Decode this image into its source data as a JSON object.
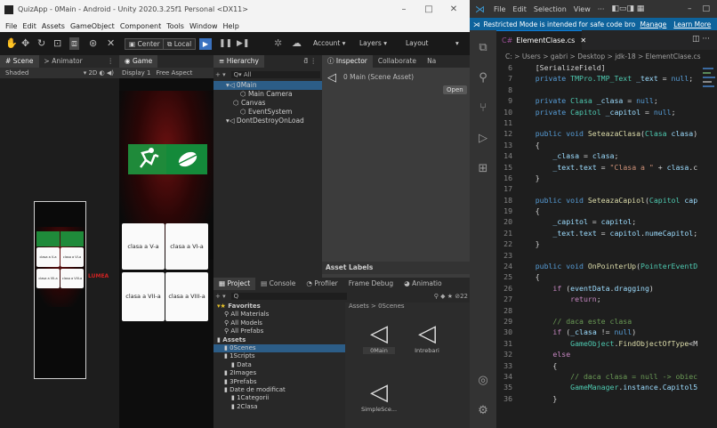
{
  "unity": {
    "title": "QuizApp - 0Main - Android - Unity 2020.3.25f1 Personal <DX11>",
    "window_controls": [
      "–",
      "□",
      "✕"
    ],
    "menu": [
      "File",
      "Edit",
      "Assets",
      "GameObject",
      "Component",
      "Tools",
      "Window",
      "Help"
    ],
    "toolbar": {
      "pivot": "Center",
      "space": "Local",
      "account": "Account ▾",
      "layers": "Layers ▾",
      "layout": "Layout"
    },
    "scene_tabs": [
      "# Scene",
      "≻ Animator"
    ],
    "scene_shading": "Shaded",
    "game_tab": "Game",
    "game_display": "Display 1",
    "game_aspect": "Free Aspect",
    "cards": [
      "clasa a V-a",
      "clasa a VI-a",
      "clasa a VII-a",
      "clasa a VIII-a"
    ],
    "scene_cards": [
      "clasa a V-a",
      "clasa a VI-a",
      "clasa a VII-a",
      "clasa a VIII-a"
    ],
    "scene_caption": "LUMEA",
    "hierarchy": {
      "tab": "Hierarchy",
      "search": "All",
      "items": [
        {
          "label": "0Main",
          "indent": 0
        },
        {
          "label": "Main Camera",
          "indent": 2
        },
        {
          "label": "Canvas",
          "indent": 1
        },
        {
          "label": "EventSystem",
          "indent": 2
        },
        {
          "label": "DontDestroyOnLoad",
          "indent": 0
        }
      ]
    },
    "inspector": {
      "tabs": [
        "Inspector",
        "Collaborate",
        "Na"
      ],
      "asset_name": "0 Main (Scene Asset)",
      "open_label": "Open",
      "asset_labels": "Asset Labels"
    },
    "project": {
      "tabs": [
        "Project",
        "Console",
        "Profiler",
        "Frame Debug",
        "Animatio"
      ],
      "badge": "22",
      "breadcrumb": "Assets > 0Scenes",
      "tree": [
        {
          "label": "Favorites",
          "indent": 0,
          "bold": true
        },
        {
          "label": "All Materials",
          "indent": 1,
          "bold": false
        },
        {
          "label": "All Models",
          "indent": 1,
          "bold": false
        },
        {
          "label": "All Prefabs",
          "indent": 1,
          "bold": false
        },
        {
          "label": "Assets",
          "indent": 0,
          "bold": true
        },
        {
          "label": "0Scenes",
          "indent": 1,
          "bold": false
        },
        {
          "label": "1Scripts",
          "indent": 1,
          "bold": false
        },
        {
          "label": "Data",
          "indent": 2,
          "bold": false
        },
        {
          "label": "2Images",
          "indent": 1,
          "bold": false
        },
        {
          "label": "3Prefabs",
          "indent": 1,
          "bold": false
        },
        {
          "label": "Date de modificat",
          "indent": 1,
          "bold": false
        },
        {
          "label": "1Categorii",
          "indent": 2,
          "bold": false
        },
        {
          "label": "2Clasa",
          "indent": 2,
          "bold": false
        }
      ],
      "assets": [
        "0Main",
        "Intrebari",
        "SimpleSce..."
      ]
    }
  },
  "vscode": {
    "menu": [
      "File",
      "Edit",
      "Selection",
      "View",
      "···"
    ],
    "window_controls": [
      "–",
      "□"
    ],
    "banner": "Restricted Mode is intended for safe code browsing...",
    "banner_links": [
      "Manage",
      "Learn More"
    ],
    "tab": "ElementClase.cs",
    "breadcrumb": "C: > Users > gabri > Desktop > jdk-18 > ElementClase.cs",
    "colors": {
      "accent": "#0e639c",
      "keyword": "#569cd6",
      "type": "#4ec9b0",
      "function": "#dcdcaa",
      "string": "#ce9178",
      "comment": "#6a9955"
    },
    "lines": [
      {
        "n": "6",
        "t": [
          [
            "cd",
            "    [SerializeField]"
          ]
        ]
      },
      {
        "n": "7",
        "t": [
          [
            "k",
            "    private "
          ],
          [
            "ty",
            "TMPro.TMP_Text"
          ],
          [
            "vr",
            " _text"
          ],
          [
            "cd",
            " = "
          ],
          [
            "k",
            "null"
          ],
          [
            "cd",
            ";"
          ]
        ]
      },
      {
        "n": "8",
        "t": []
      },
      {
        "n": "9",
        "t": [
          [
            "k",
            "    private "
          ],
          [
            "ty",
            "Clasa"
          ],
          [
            "vr",
            " _clasa"
          ],
          [
            "cd",
            " = "
          ],
          [
            "k",
            "null"
          ],
          [
            "cd",
            ";"
          ]
        ]
      },
      {
        "n": "10",
        "t": [
          [
            "k",
            "    private "
          ],
          [
            "ty",
            "Capitol"
          ],
          [
            "vr",
            " _capitol"
          ],
          [
            "cd",
            " = "
          ],
          [
            "k",
            "null"
          ],
          [
            "cd",
            ";"
          ]
        ]
      },
      {
        "n": "11",
        "t": []
      },
      {
        "n": "12",
        "t": [
          [
            "k",
            "    public void "
          ],
          [
            "fn",
            "SeteazaClasa"
          ],
          [
            "cd",
            "("
          ],
          [
            "ty",
            "Clasa"
          ],
          [
            "vr",
            " clasa"
          ],
          [
            "cd",
            ")"
          ]
        ]
      },
      {
        "n": "13",
        "t": [
          [
            "cd",
            "    {"
          ]
        ]
      },
      {
        "n": "14",
        "t": [
          [
            "vr",
            "        _clasa"
          ],
          [
            "cd",
            " = "
          ],
          [
            "vr",
            "clasa"
          ],
          [
            "cd",
            ";"
          ]
        ]
      },
      {
        "n": "15",
        "t": [
          [
            "vr",
            "        _text"
          ],
          [
            "cd",
            "."
          ],
          [
            "vr",
            "text"
          ],
          [
            "cd",
            " = "
          ],
          [
            "st",
            "\"Clasa a \""
          ],
          [
            "cd",
            " + "
          ],
          [
            "vr",
            "clasa"
          ],
          [
            "cd",
            ".c"
          ]
        ]
      },
      {
        "n": "16",
        "t": [
          [
            "cd",
            "    }"
          ]
        ]
      },
      {
        "n": "17",
        "t": []
      },
      {
        "n": "18",
        "t": [
          [
            "k",
            "    public void "
          ],
          [
            "fn",
            "SeteazaCapiol"
          ],
          [
            "cd",
            "("
          ],
          [
            "ty",
            "Capitol"
          ],
          [
            "vr",
            " cap"
          ]
        ]
      },
      {
        "n": "19",
        "t": [
          [
            "cd",
            "    {"
          ]
        ]
      },
      {
        "n": "20",
        "t": [
          [
            "vr",
            "        _capitol"
          ],
          [
            "cd",
            " = "
          ],
          [
            "vr",
            "capitol"
          ],
          [
            "cd",
            ";"
          ]
        ]
      },
      {
        "n": "21",
        "t": [
          [
            "vr",
            "        _text"
          ],
          [
            "cd",
            "."
          ],
          [
            "vr",
            "text"
          ],
          [
            "cd",
            " = "
          ],
          [
            "vr",
            "capitol"
          ],
          [
            "cd",
            "."
          ],
          [
            "vr",
            "numeCapitol"
          ],
          [
            "cd",
            ";"
          ]
        ]
      },
      {
        "n": "22",
        "t": [
          [
            "cd",
            "    }"
          ]
        ]
      },
      {
        "n": "23",
        "t": []
      },
      {
        "n": "24",
        "t": [
          [
            "k",
            "    public void "
          ],
          [
            "fn",
            "OnPointerUp"
          ],
          [
            "cd",
            "("
          ],
          [
            "ty",
            "PointerEventD"
          ]
        ]
      },
      {
        "n": "25",
        "t": [
          [
            "cd",
            "    {"
          ]
        ]
      },
      {
        "n": "26",
        "t": [
          [
            "ctl",
            "        if "
          ],
          [
            "cd",
            "("
          ],
          [
            "vr",
            "eventData"
          ],
          [
            "cd",
            "."
          ],
          [
            "vr",
            "dragging"
          ],
          [
            "cd",
            ")"
          ]
        ]
      },
      {
        "n": "27",
        "t": [
          [
            "ctl",
            "            return"
          ],
          [
            "cd",
            ";"
          ]
        ]
      },
      {
        "n": "28",
        "t": []
      },
      {
        "n": "29",
        "t": [
          [
            "cm",
            "        // daca este clasa"
          ]
        ]
      },
      {
        "n": "30",
        "t": [
          [
            "ctl",
            "        if "
          ],
          [
            "cd",
            "("
          ],
          [
            "vr",
            "_clasa"
          ],
          [
            "cd",
            " != "
          ],
          [
            "k",
            "null"
          ],
          [
            "cd",
            ")"
          ]
        ]
      },
      {
        "n": "31",
        "t": [
          [
            "ty",
            "            GameObject"
          ],
          [
            "cd",
            "."
          ],
          [
            "fn",
            "FindObjectOfType"
          ],
          [
            "cd",
            "<M"
          ]
        ]
      },
      {
        "n": "32",
        "t": [
          [
            "ctl",
            "        else"
          ]
        ]
      },
      {
        "n": "33",
        "t": [
          [
            "cd",
            "        {"
          ]
        ]
      },
      {
        "n": "34",
        "t": [
          [
            "cm",
            "            // daca clasa = null -> obiec"
          ]
        ]
      },
      {
        "n": "35",
        "t": [
          [
            "ty",
            "            GameManager"
          ],
          [
            "cd",
            "."
          ],
          [
            "vr",
            "instance"
          ],
          [
            "cd",
            "."
          ],
          [
            "vr",
            "Capitol5"
          ]
        ]
      },
      {
        "n": "36",
        "t": [
          [
            "cd",
            "        }"
          ]
        ]
      }
    ]
  }
}
